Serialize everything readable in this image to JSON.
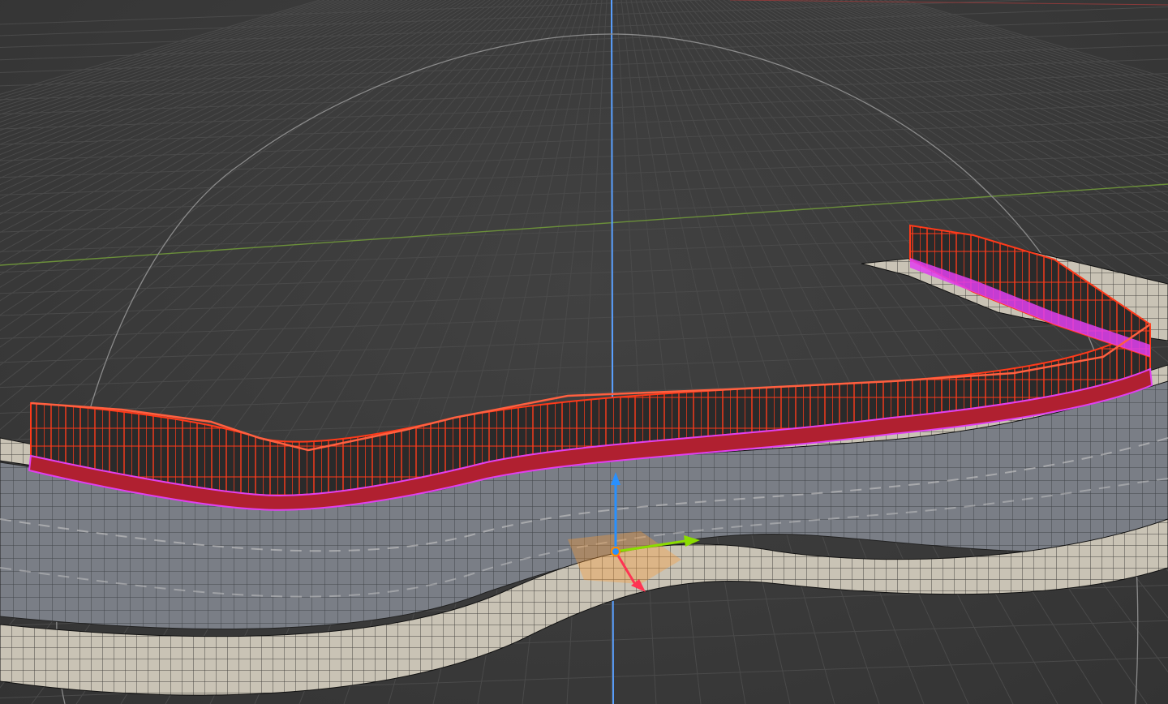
{
  "app": {
    "name": "",
    "view": "3D Viewport"
  },
  "scene": {
    "objects": [
      {
        "name": "",
        "type": "road-mesh",
        "state": "edit"
      },
      {
        "name": "",
        "type": "sidewalk-mesh",
        "state": "edit"
      },
      {
        "name": "",
        "type": "fence-mesh",
        "state": "selected"
      }
    ],
    "gizmo": {
      "mode": "move",
      "axes": [
        "x",
        "y",
        "z"
      ]
    }
  },
  "colors": {
    "background": "#3a3a3a",
    "grid_line": "#4a4a4a",
    "axis_x": "#8a3a3a",
    "axis_y": "#6b8f3a",
    "axis_z": "#5aa0ff",
    "selection": "#ff3a1a",
    "selection_highlight": "#ff9a30",
    "face_selected": "#e040f0",
    "road_surface": "#7c8088",
    "sidewalk": "#c8c2b4",
    "wire_vertex": "#101010",
    "gizmo_x": "#ff3352",
    "gizmo_y": "#8bdc00",
    "gizmo_z": "#2890ff",
    "gizmo_center": "#ff8a00"
  }
}
